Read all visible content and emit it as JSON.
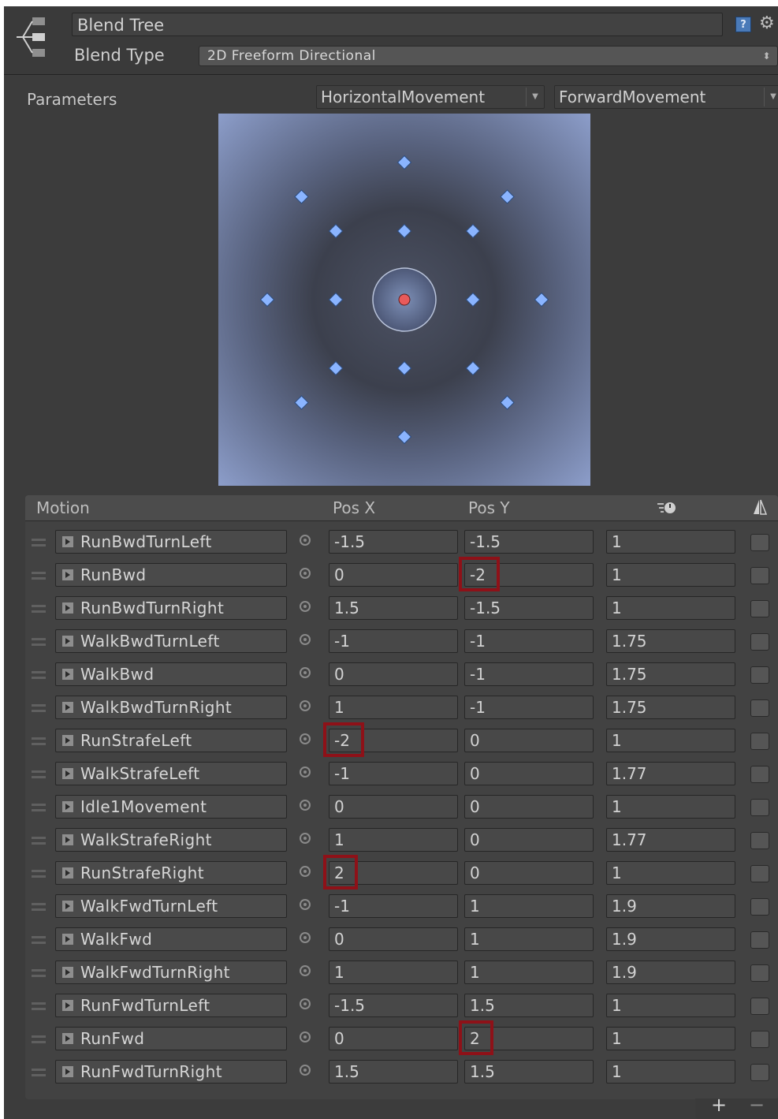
{
  "header": {
    "name": "Blend Tree",
    "blend_type_label": "Blend Type",
    "blend_type_value": "2D Freeform Directional"
  },
  "parameters": {
    "label": "Parameters",
    "x_param": "HorizontalMovement",
    "y_param": "ForwardMovement"
  },
  "blend_space": {
    "current_point": {
      "x": 0,
      "y": 0
    },
    "point_color": "#8ab4ff",
    "current_color": "#e85a5a"
  },
  "table": {
    "headers": {
      "motion": "Motion",
      "pos_x": "Pos X",
      "pos_y": "Pos Y"
    },
    "rows": [
      {
        "name": "RunBwdTurnLeft",
        "x": "-1.5",
        "y": "-1.5",
        "speed": "1"
      },
      {
        "name": "RunBwd",
        "x": "0",
        "y": "-2",
        "speed": "1"
      },
      {
        "name": "RunBwdTurnRight",
        "x": "1.5",
        "y": "-1.5",
        "speed": "1"
      },
      {
        "name": "WalkBwdTurnLeft",
        "x": "-1",
        "y": "-1",
        "speed": "1.75"
      },
      {
        "name": "WalkBwd",
        "x": "0",
        "y": "-1",
        "speed": "1.75"
      },
      {
        "name": "WalkBwdTurnRight",
        "x": "1",
        "y": "-1",
        "speed": "1.75"
      },
      {
        "name": "RunStrafeLeft",
        "x": "-2",
        "y": "0",
        "speed": "1"
      },
      {
        "name": "WalkStrafeLeft",
        "x": "-1",
        "y": "0",
        "speed": "1.77"
      },
      {
        "name": "Idle1Movement",
        "x": "0",
        "y": "0",
        "speed": "1"
      },
      {
        "name": "WalkStrafeRight",
        "x": "1",
        "y": "0",
        "speed": "1.77"
      },
      {
        "name": "RunStrafeRight",
        "x": "2",
        "y": "0",
        "speed": "1"
      },
      {
        "name": "WalkFwdTurnLeft",
        "x": "-1",
        "y": "1",
        "speed": "1.9"
      },
      {
        "name": "WalkFwd",
        "x": "0",
        "y": "1",
        "speed": "1.9"
      },
      {
        "name": "WalkFwdTurnRight",
        "x": "1",
        "y": "1",
        "speed": "1.9"
      },
      {
        "name": "RunFwdTurnLeft",
        "x": "-1.5",
        "y": "1.5",
        "speed": "1"
      },
      {
        "name": "RunFwd",
        "x": "0",
        "y": "2",
        "speed": "1"
      },
      {
        "name": "RunFwdTurnRight",
        "x": "1.5",
        "y": "1.5",
        "speed": "1"
      }
    ],
    "highlights": [
      {
        "row": 1,
        "col": "y"
      },
      {
        "row": 6,
        "col": "x"
      },
      {
        "row": 10,
        "col": "x"
      },
      {
        "row": 15,
        "col": "y"
      }
    ],
    "highlight_color": "#8e1118"
  },
  "footer": {
    "add": "+",
    "remove": "−"
  }
}
